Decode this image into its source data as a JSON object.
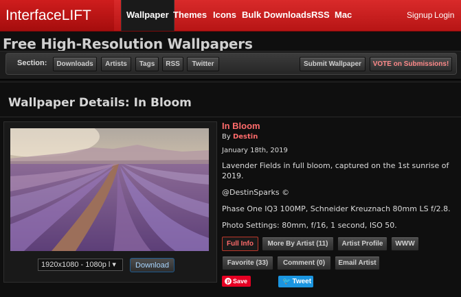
{
  "brand": {
    "logo": "InterfaceLIFT",
    "accent": "#cc1f1f",
    "link_color": "#ff6b6b"
  },
  "nav": {
    "items": [
      {
        "label": "Wallpaper",
        "active": true
      },
      {
        "label": "Themes"
      },
      {
        "label": "Icons"
      },
      {
        "label": "Bulk Downloads"
      },
      {
        "label": "RSS"
      },
      {
        "label": "Mac"
      }
    ],
    "signup": "Signup",
    "login": "Login"
  },
  "page_title": "Free High-Resolution Wallpapers",
  "section": {
    "label": "Section:",
    "buttons": [
      "Downloads",
      "Artists",
      "Tags",
      "RSS",
      "Twitter"
    ],
    "submit": "Submit Wallpaper",
    "vote": "VOTE on Submissions!"
  },
  "details": {
    "title": "Wallpaper Details: In Bloom",
    "name": "In Bloom",
    "by_prefix": "By",
    "artist": "Destin",
    "date": "January 18th, 2019",
    "description": "Lavender Fields in full bloom, captured on the 1st sunrise of 2019.",
    "handle": "@DestinSparks ©",
    "camera": "Phase One IQ3 100MP, Schneider Kreuznach 80mm LS f/2.8.",
    "settings": "Photo Settings: 80mm, f/16, 1 second, ISO 50."
  },
  "download": {
    "resolution": "1920x1080 - 1080p l ▾",
    "button": "Download"
  },
  "actions": {
    "full_info": "Full Info",
    "more_by_artist": "More By Artist (11)",
    "artist_profile": "Artist Profile",
    "www": "WWW",
    "favorite": "Favorite (33)",
    "comment": "Comment (0)",
    "email_artist": "Email Artist"
  },
  "social": {
    "save": "Save",
    "tweet": "Tweet"
  }
}
